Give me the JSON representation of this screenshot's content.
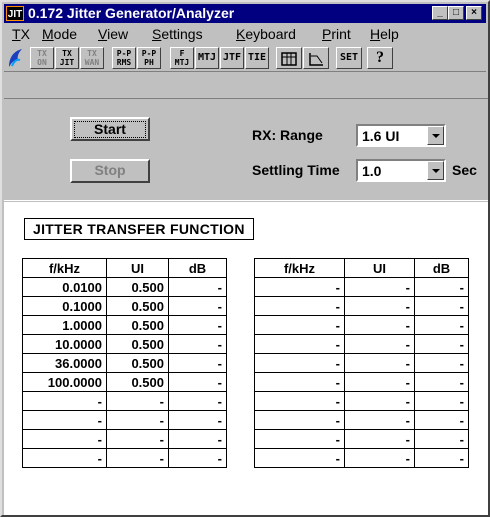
{
  "app": {
    "title": "0.172 Jitter Generator/Analyzer",
    "icon_label": "JIT"
  },
  "window_controls": {
    "minimize": "_",
    "maximize": "□",
    "close": "×"
  },
  "menu": [
    {
      "label": "TX",
      "underline": "T",
      "rest": "X"
    },
    {
      "label": "Mode",
      "underline": "M",
      "rest": "ode"
    },
    {
      "label": "View",
      "underline": "V",
      "rest": "iew"
    },
    {
      "label": "Settings",
      "underline": "S",
      "rest": "ettings"
    },
    {
      "label": "Keyboard",
      "underline": "K",
      "rest": "eyboard"
    },
    {
      "label": "Print",
      "underline": "P",
      "rest": "rint"
    },
    {
      "label": "Help",
      "underline": "H",
      "rest": "elp"
    }
  ],
  "toolbar": {
    "tx_on": {
      "l1": "TX",
      "l2": "ON"
    },
    "tx_jit": {
      "l1": "TX",
      "l2": "JIT"
    },
    "tx_wan": {
      "l1": "TX",
      "l2": "WAN"
    },
    "pp_rms": {
      "l1": "P-P",
      "l2": "RMS"
    },
    "pp_ph": {
      "l1": "P-P",
      "l2": "PH"
    },
    "f_mtj": {
      "l1": "F",
      "l2": "MTJ"
    },
    "mtj": "MTJ",
    "jtf": "JTF",
    "tie": "TIE",
    "set": "SET",
    "help": "?"
  },
  "controls": {
    "start_label": "Start",
    "stop_label": "Stop",
    "rx_range_label": "RX: Range",
    "rx_range_value": "1.6 UI",
    "settling_label": "Settling Time",
    "settling_value": "1.0",
    "settling_unit": "Sec"
  },
  "section_title": "JITTER TRANSFER FUNCTION",
  "table_left": {
    "headers": [
      "f/kHz",
      "UI",
      "dB"
    ],
    "rows": [
      [
        "0.0100",
        "0.500",
        "-"
      ],
      [
        "0.1000",
        "0.500",
        "-"
      ],
      [
        "1.0000",
        "0.500",
        "-"
      ],
      [
        "10.0000",
        "0.500",
        "-"
      ],
      [
        "36.0000",
        "0.500",
        "-"
      ],
      [
        "100.0000",
        "0.500",
        "-"
      ],
      [
        "-",
        "-",
        "-"
      ],
      [
        "-",
        "-",
        "-"
      ],
      [
        "-",
        "-",
        "-"
      ],
      [
        "-",
        "-",
        "-"
      ]
    ]
  },
  "table_right": {
    "headers": [
      "f/kHz",
      "UI",
      "dB"
    ],
    "rows": [
      [
        "-",
        "-",
        "-"
      ],
      [
        "-",
        "-",
        "-"
      ],
      [
        "-",
        "-",
        "-"
      ],
      [
        "-",
        "-",
        "-"
      ],
      [
        "-",
        "-",
        "-"
      ],
      [
        "-",
        "-",
        "-"
      ],
      [
        "-",
        "-",
        "-"
      ],
      [
        "-",
        "-",
        "-"
      ],
      [
        "-",
        "-",
        "-"
      ],
      [
        "-",
        "-",
        "-"
      ]
    ]
  },
  "colors": {
    "titlebar": "#000080",
    "face": "#c0c0c0"
  }
}
